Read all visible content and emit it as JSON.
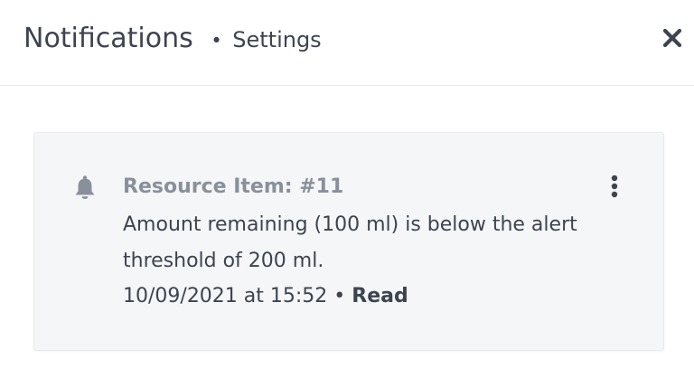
{
  "header": {
    "title": "Notifications",
    "separator": "•",
    "subtitle": "Settings",
    "close_icon": "close-icon"
  },
  "notification": {
    "icon": "bell-icon",
    "menu_icon": "more-vertical-icon",
    "title": "Resource Item: #11",
    "message": "Amount remaining (100 ml) is below the alert threshold of 200 ml.",
    "timestamp": "10/09/2021 at 15:52",
    "separator": "•",
    "status": "Read"
  },
  "colors": {
    "text": "#3d4450",
    "muted": "#8a909b",
    "card_bg": "#f5f6f8",
    "icon": "#8a909b"
  }
}
